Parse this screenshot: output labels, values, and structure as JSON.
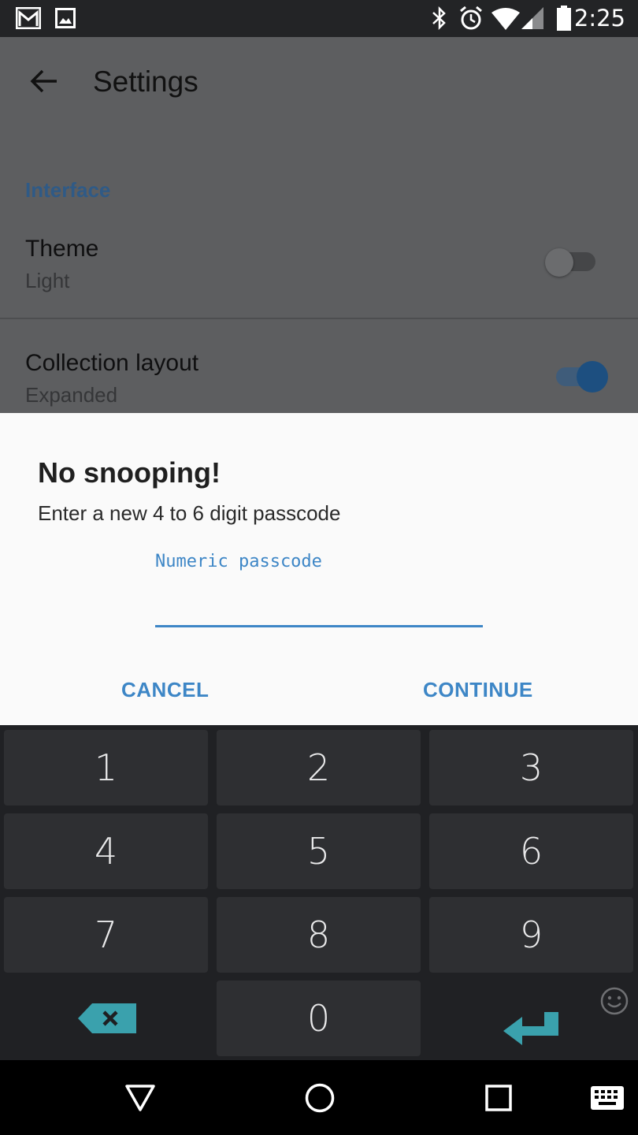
{
  "status_bar": {
    "time": "2:25",
    "icons": [
      "gmail-icon",
      "gallery-icon",
      "bluetooth-icon",
      "alarm-icon",
      "wifi-icon",
      "signal-icon",
      "battery-icon"
    ]
  },
  "app_bar": {
    "title": "Settings",
    "back_icon": "arrow-back-icon"
  },
  "settings": {
    "section_label": "Interface",
    "rows": [
      {
        "title": "Theme",
        "subtitle": "Light",
        "toggle_on": false
      },
      {
        "title": "Collection layout",
        "subtitle": "Expanded",
        "toggle_on": true
      }
    ]
  },
  "dialog": {
    "title": "No snooping!",
    "message": "Enter a new 4 to 6 digit passcode",
    "input_label": "Numeric passcode",
    "input_value": "",
    "cancel_label": "CANCEL",
    "continue_label": "CONTINUE"
  },
  "keyboard": {
    "keys": [
      "1",
      "2",
      "3",
      "4",
      "5",
      "6",
      "7",
      "8",
      "9",
      "0"
    ],
    "extra_icons": [
      "backspace-icon",
      "enter-icon",
      "emoji-icon"
    ]
  },
  "nav_bar": {
    "icons": [
      "back-triangle-icon",
      "home-circle-icon",
      "recents-square-icon",
      "keyboard-switch-icon"
    ]
  },
  "colors": {
    "accent": "#3d86c6",
    "scrim": "#5d5e60",
    "keyboard_bg": "#202124",
    "key_bg": "#2e2f32",
    "key_accent": "#3aa1ad",
    "toggle_on": "#1d4f80"
  }
}
